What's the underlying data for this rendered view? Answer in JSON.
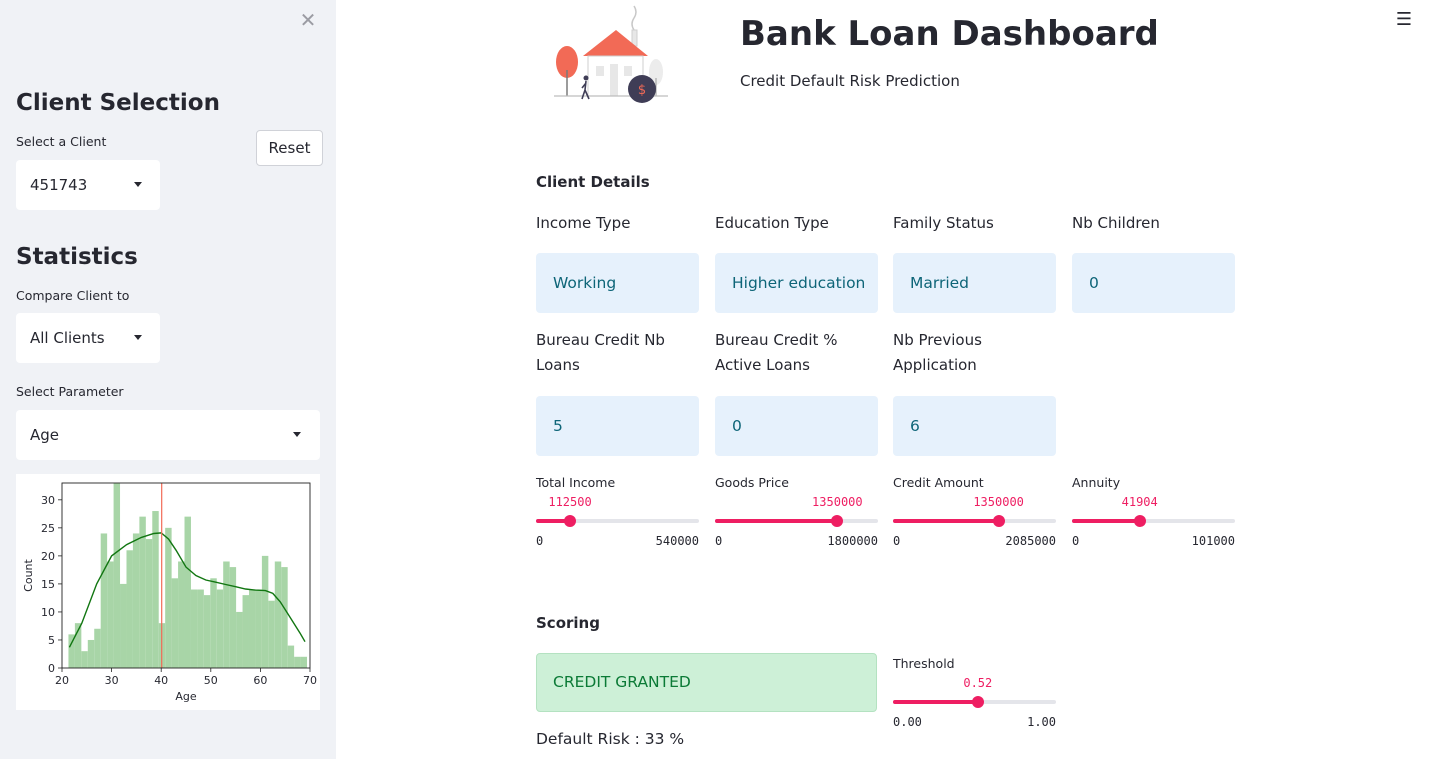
{
  "sidebar": {
    "close_icon": "close-icon",
    "client_selection_heading": "Client Selection",
    "select_client_label": "Select a Client",
    "selected_client": "451743",
    "reset_label": "Reset",
    "statistics_heading": "Statistics",
    "compare_label": "Compare Client to",
    "compare_value": "All Clients",
    "parameter_label": "Select Parameter",
    "parameter_value": "Age"
  },
  "chart_data": {
    "type": "bar",
    "title": "",
    "xlabel": "Age",
    "ylabel": "Count",
    "xlim": [
      20,
      70
    ],
    "ylim": [
      0,
      33
    ],
    "xticks": [
      "20",
      "30",
      "40",
      "50",
      "60",
      "70"
    ],
    "yticks": [
      "0",
      "5",
      "10",
      "15",
      "20",
      "25",
      "30"
    ],
    "bin_width": 1.3,
    "bin_starts": [
      21.3,
      22.6,
      23.9,
      25.2,
      26.5,
      27.8,
      29.1,
      30.4,
      31.7,
      33.0,
      34.3,
      35.6,
      36.9,
      38.2,
      39.5,
      40.8,
      42.1,
      43.4,
      44.7,
      46.0,
      47.3,
      48.6,
      49.9,
      51.2,
      52.5,
      53.8,
      55.1,
      56.4,
      57.7,
      59.0,
      60.3,
      61.6,
      62.9,
      64.2,
      65.5,
      66.8,
      68.1
    ],
    "values": [
      6,
      8,
      3,
      5,
      7,
      24,
      19,
      33,
      15,
      21,
      24,
      27,
      23,
      28,
      8,
      25,
      16,
      19,
      27,
      14,
      14,
      13,
      16,
      14,
      19,
      18,
      10,
      13,
      14,
      14,
      20,
      12,
      19,
      18,
      4,
      2,
      2
    ],
    "kde": [
      [
        21.5,
        3.7
      ],
      [
        24,
        8
      ],
      [
        27,
        15
      ],
      [
        30,
        20
      ],
      [
        33,
        22
      ],
      [
        36,
        23.3
      ],
      [
        38.5,
        24
      ],
      [
        40,
        24.1
      ],
      [
        41.5,
        23
      ],
      [
        43,
        21
      ],
      [
        45,
        18
      ],
      [
        47,
        16.5
      ],
      [
        49,
        15.7
      ],
      [
        51,
        15.3
      ],
      [
        53,
        14.9
      ],
      [
        55,
        14.5
      ],
      [
        57,
        14.1
      ],
      [
        59,
        13.9
      ],
      [
        61,
        13.8
      ],
      [
        62.5,
        13.3
      ],
      [
        64,
        11.8
      ],
      [
        66,
        9
      ],
      [
        68,
        6.2
      ],
      [
        69,
        4.7
      ]
    ],
    "client_value": 40.1,
    "bar_color": "#a8d5a7",
    "kde_color": "#117611",
    "marker_color": "#f26a56"
  },
  "header": {
    "title": "Bank Loan Dashboard",
    "subtitle": "Credit Default Risk Prediction",
    "menu_icon": "hamburger-menu-icon"
  },
  "client_details": {
    "heading": "Client Details",
    "fields": [
      {
        "label": "Income Type",
        "value": "Working"
      },
      {
        "label": "Education Type",
        "value": "Higher education"
      },
      {
        "label": "Family Status",
        "value": "Married"
      },
      {
        "label": "Nb Children",
        "value": "0"
      },
      {
        "label_line1": "Bureau Credit Nb",
        "label_line2": "Loans",
        "value": "5"
      },
      {
        "label_line1": "Bureau Credit %",
        "label_line2": "Active Loans",
        "value": "0"
      },
      {
        "label_line1": "Nb Previous",
        "label_line2": "Application",
        "value": "6"
      }
    ],
    "sliders": [
      {
        "label": "Total Income",
        "value": "112500",
        "min": "0",
        "max": "540000",
        "fraction": 0.2083
      },
      {
        "label": "Goods Price",
        "value": "1350000",
        "min": "0",
        "max": "1800000",
        "fraction": 0.75
      },
      {
        "label": "Credit Amount",
        "value": "1350000",
        "min": "0",
        "max": "2085000",
        "fraction": 0.6475
      },
      {
        "label": "Annuity",
        "value": "41904",
        "min": "0",
        "max": "101000",
        "fraction": 0.4149
      }
    ]
  },
  "scoring": {
    "heading": "Scoring",
    "decision": "CREDIT GRANTED",
    "default_risk": "Default Risk : 33 %",
    "threshold": {
      "label": "Threshold",
      "value": "0.52",
      "min": "0.00",
      "max": "1.00",
      "fraction": 0.52
    }
  },
  "colors": {
    "accent": "#ee1e62",
    "info_bg": "#e6f1fc",
    "info_text": "#0e6578",
    "success_bg": "#cdf0d7",
    "success_text": "#0b7a36",
    "sidebar_bg": "#f0f2f6"
  }
}
